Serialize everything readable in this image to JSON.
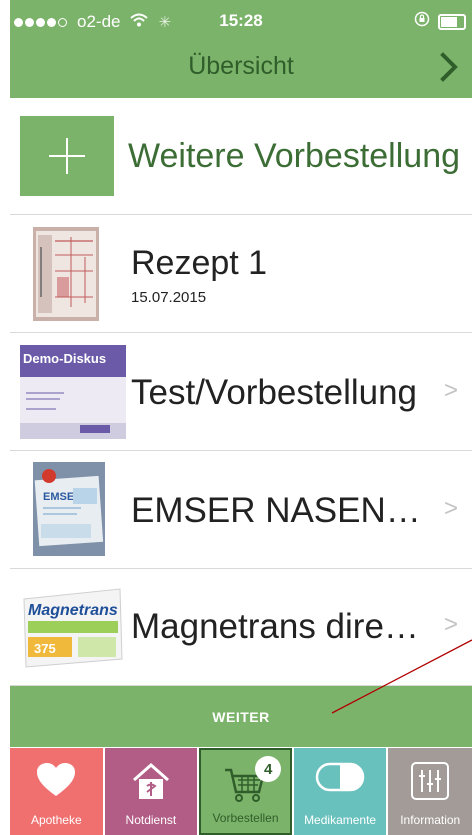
{
  "status_bar": {
    "carrier": "o2-de",
    "time": "15:28"
  },
  "nav": {
    "title": "Übersicht"
  },
  "add_row": {
    "label": "Weitere Vorbestellung"
  },
  "items": [
    {
      "title": "Rezept 1",
      "date": "15.07.2015"
    },
    {
      "title": "Test/Vorbestellung"
    },
    {
      "title": "EMSER NASENSP…"
    },
    {
      "title": "Magnetrans direkt…"
    }
  ],
  "thumb_texts": {
    "demo": "Demo-Diskus",
    "emser": "EMSER",
    "magnetrans": "Magnetrans",
    "magnetrans_dose": "375"
  },
  "weiter_label": "WEITER",
  "tabs": [
    {
      "label": "Apotheke",
      "icon": "heart-icon",
      "color": "#f07070"
    },
    {
      "label": "Notdienst",
      "icon": "pharmacy-house-icon",
      "color": "#b25d86"
    },
    {
      "label": "Vorbestellen",
      "icon": "cart-icon",
      "color": "#7cb36a",
      "badge": "4"
    },
    {
      "label": "Medikamente",
      "icon": "pill-icon",
      "color": "#69c1bd"
    },
    {
      "label": "Information",
      "icon": "sliders-icon",
      "color": "#a29b98"
    }
  ],
  "colors": {
    "brand_green": "#7cb36a",
    "dark_green": "#2f5e2a",
    "annotation_red": "#b00000"
  }
}
